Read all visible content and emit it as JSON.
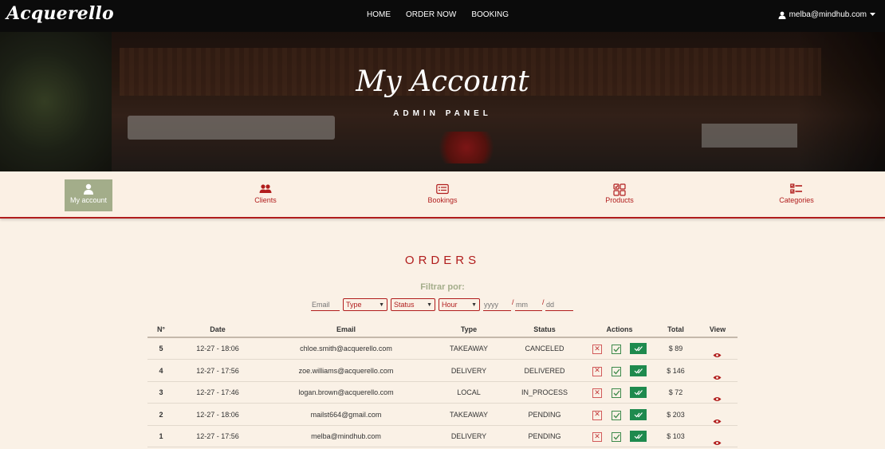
{
  "navbar": {
    "brand": "Acquerello",
    "links": [
      "HOME",
      "ORDER NOW",
      "BOOKING"
    ],
    "user_email": "melba@mindhub.com",
    "user_icon": "user-icon",
    "caret_icon": "caret-down-icon"
  },
  "hero": {
    "title": "My Account",
    "subtitle": "ADMIN PANEL"
  },
  "admin_nav": {
    "items": [
      {
        "label": "My account",
        "icon": "user-icon",
        "active": true
      },
      {
        "label": "Clients",
        "icon": "users-icon",
        "active": false
      },
      {
        "label": "Bookings",
        "icon": "list-card-icon",
        "active": false
      },
      {
        "label": "Products",
        "icon": "grid-icon",
        "active": false
      },
      {
        "label": "Categories",
        "icon": "checklist-icon",
        "active": false
      }
    ]
  },
  "orders": {
    "title": "ORDERS",
    "filter_label": "Filtrar por:",
    "filters": {
      "email_placeholder": "Email",
      "type": "Type",
      "status": "Status",
      "hour": "Hour",
      "year_placeholder": "yyyy",
      "month_placeholder": "mm",
      "day_placeholder": "dd",
      "separator": "/"
    },
    "columns": [
      "N°",
      "Date",
      "Email",
      "Type",
      "Status",
      "Actions",
      "Total",
      "View"
    ],
    "rows": [
      {
        "num": "5",
        "date": "12-27 - 18:06",
        "email": "chloe.smith@acquerello.com",
        "type": "TAKEAWAY",
        "status": "CANCELED",
        "total": "$ 89"
      },
      {
        "num": "4",
        "date": "12-27 - 17:56",
        "email": "zoe.williams@acquerello.com",
        "type": "DELIVERY",
        "status": "DELIVERED",
        "total": "$ 146"
      },
      {
        "num": "3",
        "date": "12-27 - 17:46",
        "email": "logan.brown@acquerello.com",
        "type": "LOCAL",
        "status": "IN_PROCESS",
        "total": "$ 72"
      },
      {
        "num": "2",
        "date": "12-27 - 18:06",
        "email": "mailst664@gmail.com",
        "type": "TAKEAWAY",
        "status": "PENDING",
        "total": "$ 203"
      },
      {
        "num": "1",
        "date": "12-27 - 17:56",
        "email": "melba@mindhub.com",
        "type": "DELIVERY",
        "status": "PENDING",
        "total": "$ 103"
      }
    ]
  },
  "colors": {
    "accent": "#b11d1d",
    "sage": "#a3ad8a",
    "background": "#faf1e6",
    "success": "#1e8a4e"
  }
}
